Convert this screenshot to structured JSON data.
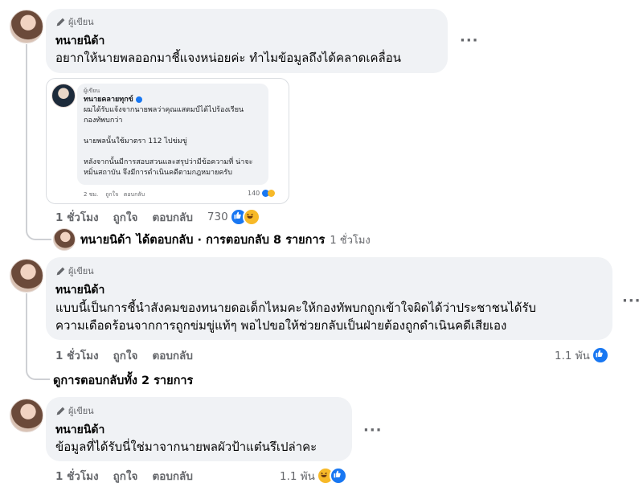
{
  "comments": [
    {
      "author_badge": "ผู้เขียน",
      "name": "ทนายนิด้า",
      "text": "อยากให้นายพลออกมาชี้แจงหน่อยค่ะ ทำไมข้อมูลถึงได้คลาดเคลื่อน",
      "time": "1 ชั่วโมง",
      "like": "ถูกใจ",
      "reply": "ตอบกลับ",
      "reaction_count": "730"
    },
    {
      "author_badge": "ผู้เขียน",
      "name": "ทนายนิด้า",
      "text_line1": "แบบนี้เป็นการชี้นำสังคมของทนายดอเด็กไหมคะให้กองทัพบกถูกเข้าใจผิดได้ว่าประชาชนได้รับ",
      "text_line2": "ความเดือดร้อนจากการถูกข่มขู่แท้ๆ พอไปขอให้ช่วยกลับเป็นฝ่ายต้องถูกดำเนินคดีเสียเอง",
      "time": "1 ชั่วโมง",
      "like": "ถูกใจ",
      "reply": "ตอบกลับ",
      "reaction_count": "1.1 พัน"
    },
    {
      "author_badge": "ผู้เขียน",
      "name": "ทนายนิด้า",
      "text": "ข้อมูลที่ได้รับนี่ใช่มาจากนายพลผัวป้าแต๋นรึเปล่าคะ",
      "time": "1 ชั่วโมง",
      "like": "ถูกใจ",
      "reply": "ตอบกลับ",
      "reaction_count": "1.1 พัน"
    }
  ],
  "embedded": {
    "badge": "ผู้เขียน",
    "name": "ทนายคลายทุกข์",
    "line1": "ผมได้รับแจ้งจากนายพลว่าคุณแสตมป์ได้ไปร้องเรียน",
    "line2": "กองทัพบกว่า",
    "line3": "นายพลนั้นใช้มาตรา 112 ไปข่มขู่",
    "line4": "หลังจากนั้นมีการสอบสวนและสรุปว่ามีข้อความที่ น่าจะ",
    "line5": "หมิ่นสถาบัน จึงมีการดำเนินคดีตามกฎหมายครับ",
    "time": "2 ชม.",
    "like": "ถูกใจ",
    "reply": "ตอบกลับ",
    "reaction_count": "140"
  },
  "reply_summary": {
    "name": "ทนายนิด้า",
    "text": "ได้ตอบกลับ · การตอบกลับ 8 รายการ",
    "time": "1 ชั่วโมง"
  },
  "view_replies": "ดูการตอบกลับทั้ง 2 รายการ",
  "more_label": "···",
  "colors": {
    "bubble": "#f0f2f5",
    "meta": "#65676b",
    "like_blue": "#1877f2",
    "haha_yellow": "#f7b928"
  }
}
